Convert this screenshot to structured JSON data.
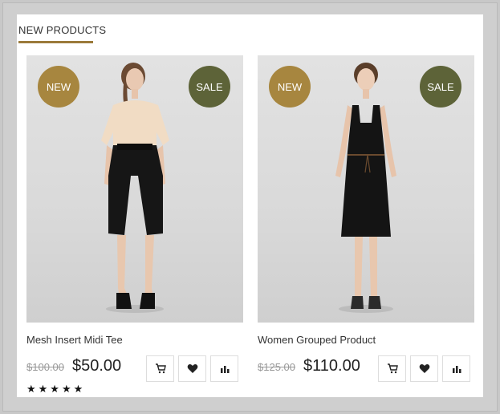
{
  "section": {
    "title": "NEW PRODUCTS"
  },
  "products": [
    {
      "badge_new": "NEW",
      "badge_sale": "SALE",
      "name": "Mesh Insert Midi Tee",
      "old_price": "$100.00",
      "price": "$50.00",
      "rating": "★★★★★",
      "rating_value": 5
    },
    {
      "badge_new": "NEW",
      "badge_sale": "SALE",
      "name": "Women Grouped Product",
      "old_price": "$125.00",
      "price": "$110.00"
    }
  ],
  "icons": {
    "add_to_cart": "cart-icon",
    "wishlist": "heart-icon",
    "compare": "bar-chart-icon"
  },
  "colors": {
    "accent_gold": "#a7863f",
    "accent_olive": "#5d6338",
    "background": "#c8c8c8"
  }
}
